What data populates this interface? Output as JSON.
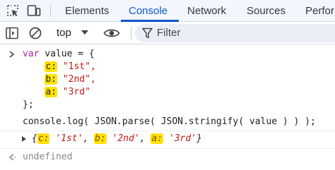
{
  "tabs": {
    "elements": "Elements",
    "console": "Console",
    "network": "Network",
    "sources": "Sources",
    "performance": "Perfor"
  },
  "toolbar": {
    "context": "top",
    "filter_placeholder": "Filter"
  },
  "console": {
    "input": {
      "decl_keyword": "var",
      "decl_rest": " value = {",
      "props": [
        {
          "key": "c:",
          "value": "\"1st\","
        },
        {
          "key": "b:",
          "value": "\"2nd\","
        },
        {
          "key": "a:",
          "value": "\"3rd\""
        }
      ],
      "close": "};",
      "call": "console.log( JSON.parse( JSON.stringify( value ) ) );"
    },
    "output": {
      "open": "{",
      "entries": [
        {
          "key": "c:",
          "value": "'1st'",
          "sep": ", "
        },
        {
          "key": "b:",
          "value": "'2nd'",
          "sep": ", "
        },
        {
          "key": "a:",
          "value": "'3rd'",
          "sep": ""
        }
      ],
      "close": "}"
    },
    "return_value": "undefined"
  },
  "colors": {
    "accent": "#0b57d0",
    "highlight": "#ffe100",
    "keyword": "#a626a4",
    "string": "#c41a16"
  }
}
